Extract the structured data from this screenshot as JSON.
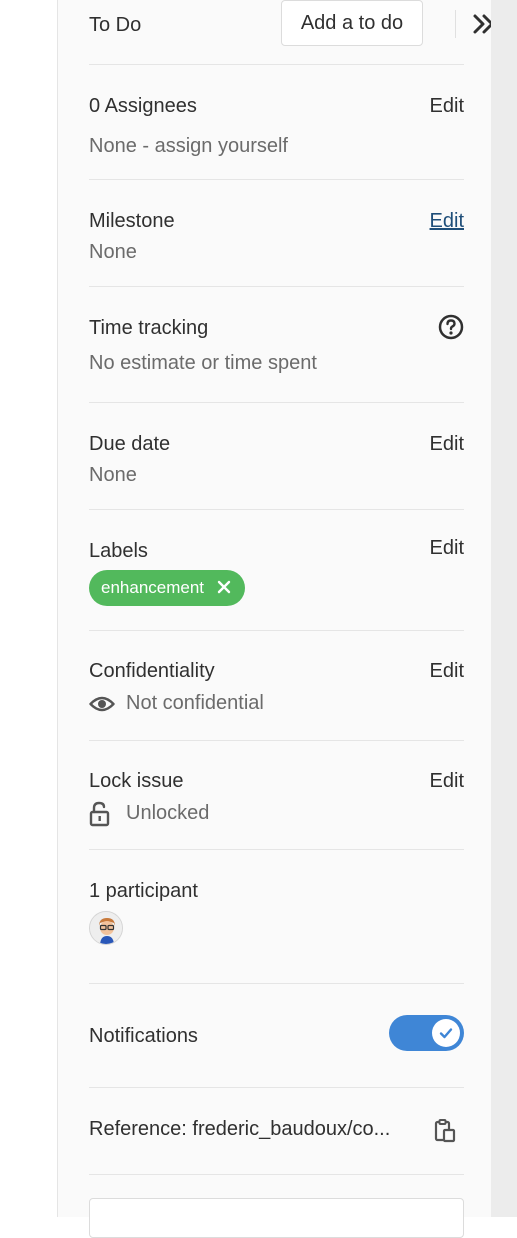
{
  "todo": {
    "title": "To Do",
    "button_label": "Add a to do",
    "collapse_icon": "double-chevron-right-icon"
  },
  "assignees": {
    "title": "0 Assignees",
    "edit_label": "Edit",
    "value": "None - assign yourself"
  },
  "milestone": {
    "title": "Milestone",
    "edit_label": "Edit",
    "value": "None"
  },
  "time_tracking": {
    "title": "Time tracking",
    "help_icon": "question-circle-icon",
    "value": "No estimate or time spent"
  },
  "due_date": {
    "title": "Due date",
    "edit_label": "Edit",
    "value": "None"
  },
  "labels": {
    "title": "Labels",
    "edit_label": "Edit",
    "items": [
      {
        "name": "enhancement",
        "color": "#52b95c"
      }
    ]
  },
  "confidentiality": {
    "title": "Confidentiality",
    "edit_label": "Edit",
    "value": "Not confidential",
    "icon": "eye-icon"
  },
  "lock": {
    "title": "Lock issue",
    "edit_label": "Edit",
    "value": "Unlocked",
    "icon": "unlock-icon"
  },
  "participants": {
    "title": "1 participant"
  },
  "notifications": {
    "title": "Notifications",
    "enabled": true,
    "toggle_color": "#3f86d6"
  },
  "reference": {
    "text": "Reference: frederic_baudoux/co...",
    "copy_icon": "clipboard-icon"
  }
}
